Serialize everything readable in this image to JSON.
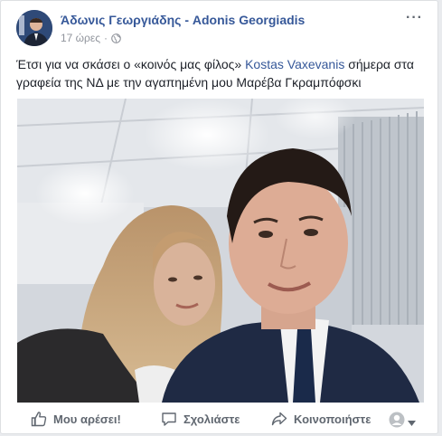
{
  "post": {
    "author": "Άδωνις Γεωργιάδης - Adonis Georgiadis",
    "time": "17 ώρες",
    "separator": "·",
    "more_label": "···",
    "text_before": "Έτσι για να σκάσει ο «κοινός μας φίλος» ",
    "text_link": "Kostas Vaxevanis",
    "text_after": " σήμερα στα γραφεία της ΝΔ με την αγαπημένη μου Μαρέβα Γκραμπόφσκι",
    "audience_icon": "globe-icon"
  },
  "actions": {
    "like_label": "Μου αρέσει!",
    "comment_label": "Σχολιάστε",
    "share_label": "Κοινοποιήστε"
  },
  "colors": {
    "link": "#365899",
    "text": "#1d2129",
    "muted": "#606770",
    "meta": "#90949c"
  }
}
